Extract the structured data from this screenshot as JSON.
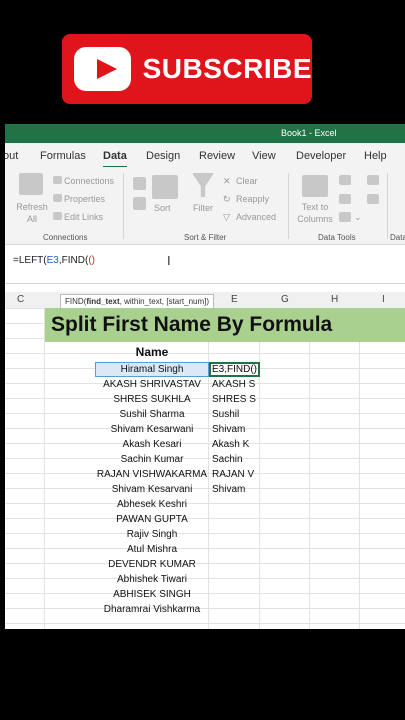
{
  "banner": {
    "text": "SUBSCRIBE"
  },
  "window": {
    "title": "Book1  -  Excel"
  },
  "tabs": [
    "out",
    "Formulas",
    "Data",
    "Design",
    "Review",
    "View",
    "Developer",
    "Help"
  ],
  "ribbon": {
    "refresh_all": "Refresh All",
    "connections": "Connections",
    "properties": "Properties",
    "edit_links": "Edit Links",
    "sort": "Sort",
    "filter": "Filter",
    "clear": "Clear",
    "reapply": "Reapply",
    "advanced": "Advanced",
    "text_to_columns": "Text to Columns",
    "group_connections": "Connections",
    "group_sort_filter": "Sort & Filter",
    "group_data_tools": "Data Tools",
    "group_data_trunc": "Data"
  },
  "formula_bar": {
    "prefix": "=LEFT(",
    "ref": "E3",
    "mid": ",FIND(",
    "paren": "()"
  },
  "columns": [
    "C",
    "D",
    "E",
    "F",
    "G",
    "H",
    "I"
  ],
  "tooltip": {
    "fn": "FIND(",
    "arg1": "find_text",
    "rest": ", within_text, [start_num])"
  },
  "sheet": {
    "title": "Split First Name By Formula",
    "header": "Name",
    "names": [
      "Hiramal Singh",
      "AKASH SHRIVASTAV",
      "SHRES SUKHLA",
      "Sushil Sharma",
      "Shivam Kesarwani",
      "Akash Kesari",
      "Sachin Kumar",
      "RAJAN VISHWAKARMA",
      "Shivam Kesarvani",
      "Abhesek Keshri",
      "PAWAN GUPTA",
      "Rajiv Singh",
      "Atul Mishra",
      "DEVENDR KUMAR",
      "Abhishek Tiwari",
      "ABHISEK SINGH",
      "Dharamrai Vishkarma"
    ],
    "first_names": [
      "E3,FIND()",
      "AKASH S",
      "SHRES S",
      "Sushil",
      "Shivam",
      "Akash K",
      "Sachin",
      "RAJAN V",
      "Shivam"
    ]
  }
}
